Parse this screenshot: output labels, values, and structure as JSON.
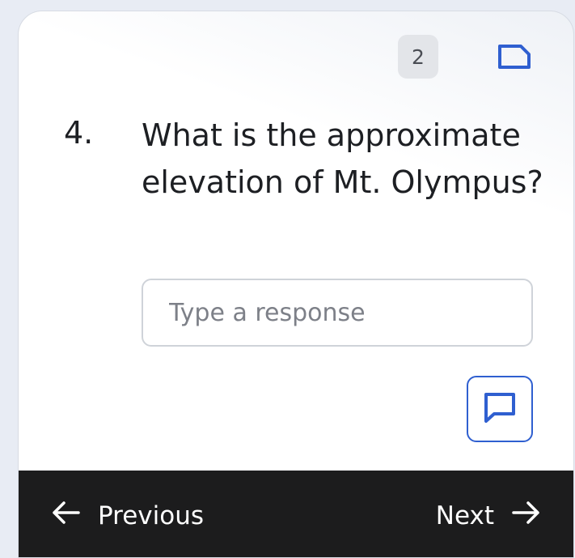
{
  "header": {
    "badge_count": "2",
    "flag_icon": "bookmark-icon"
  },
  "question": {
    "number": "4.",
    "text": "What is the approximate elevation of Mt. Olympus?"
  },
  "response": {
    "value": "",
    "placeholder": "Type a response"
  },
  "comment": {
    "icon": "comment-icon"
  },
  "footer": {
    "previous_label": "Previous",
    "next_label": "Next"
  },
  "colors": {
    "accent": "#2f5fd0",
    "footer_bg": "#1c1c1d",
    "badge_bg": "#e3e5e9"
  }
}
